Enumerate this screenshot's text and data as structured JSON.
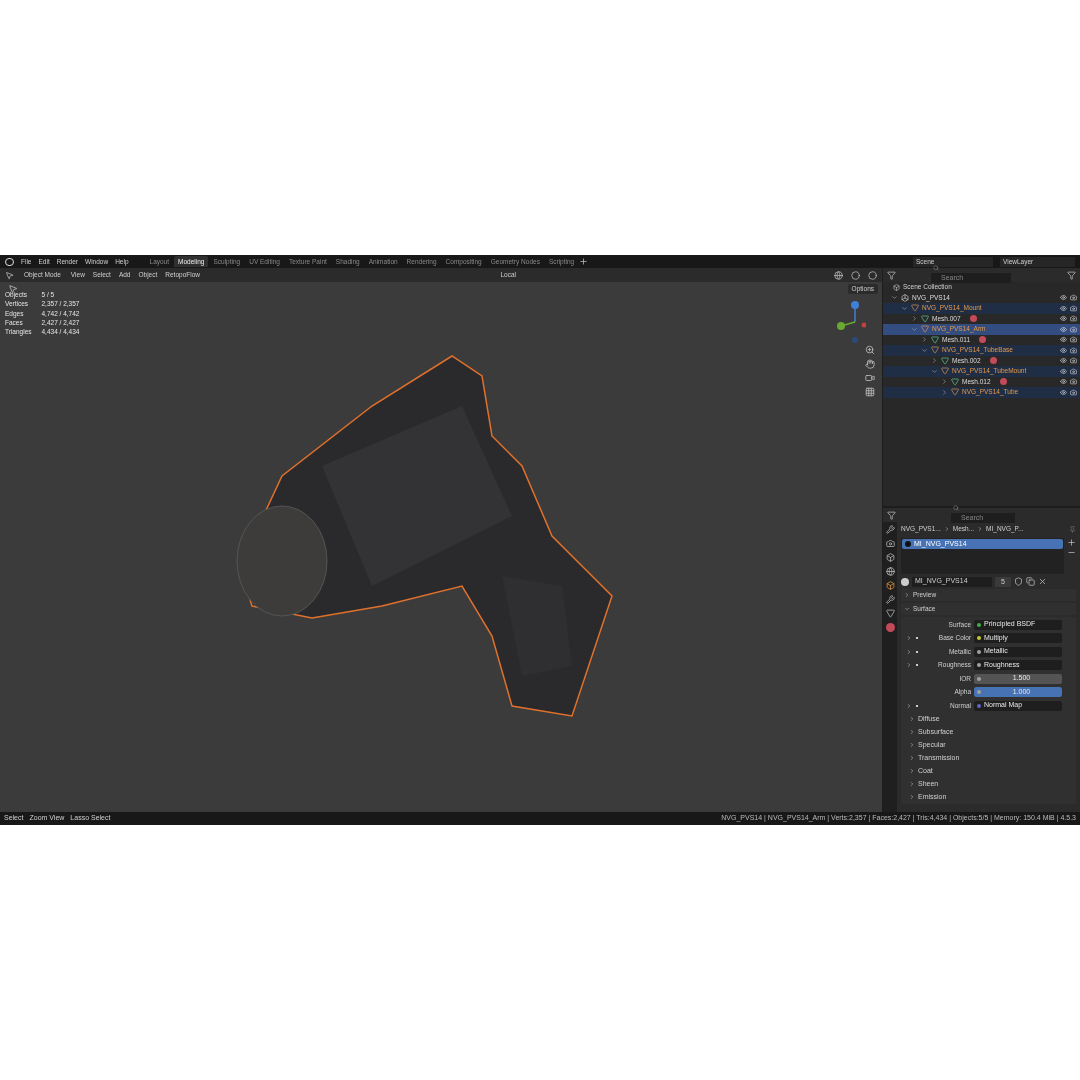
{
  "menu": [
    "File",
    "Edit",
    "Render",
    "Window",
    "Help"
  ],
  "workspaces": [
    {
      "label": "Layout",
      "selected": false
    },
    {
      "label": "Modeling",
      "selected": true
    },
    {
      "label": "Sculpting",
      "selected": false
    },
    {
      "label": "UV Editing",
      "selected": false
    },
    {
      "label": "Texture Paint",
      "selected": false
    },
    {
      "label": "Shading",
      "selected": false
    },
    {
      "label": "Animation",
      "selected": false
    },
    {
      "label": "Rendering",
      "selected": false
    },
    {
      "label": "Compositing",
      "selected": false
    },
    {
      "label": "Geometry Nodes",
      "selected": false
    },
    {
      "label": "Scripting",
      "selected": false
    }
  ],
  "scene": "Scene",
  "view_layer": "ViewLayer",
  "header": {
    "mode": "Object Mode",
    "menus": [
      "View",
      "Select",
      "Add",
      "Object",
      "RetopoFlow"
    ],
    "orientation": "Local",
    "options": "Options"
  },
  "stats": [
    {
      "label": "Objects",
      "value": "5 / 5"
    },
    {
      "label": "Vertices",
      "value": "2,357 / 2,357"
    },
    {
      "label": "Edges",
      "value": "4,742 / 4,742"
    },
    {
      "label": "Faces",
      "value": "2,427 / 2,427"
    },
    {
      "label": "Triangles",
      "value": "4,434 / 4,434"
    }
  ],
  "outliner": {
    "search": {
      "placeholder": "Search"
    },
    "root": "Scene Collection",
    "tree": [
      {
        "name": "NVG_PVS14",
        "kind": "collection",
        "selected": false,
        "active": false,
        "expanded": true,
        "children": [
          {
            "name": "NVG_PVS14_Mount",
            "kind": "object",
            "selected": true,
            "active": false,
            "expanded": true,
            "children": [
              {
                "name": "Mesh.007",
                "kind": "mesh",
                "selected": false,
                "active": false,
                "expanded": false
              },
              {
                "name": "NVG_PVS14_Arm",
                "kind": "object",
                "selected": true,
                "active": true,
                "expanded": true,
                "children": [
                  {
                    "name": "Mesh.011",
                    "kind": "mesh",
                    "selected": false,
                    "active": false,
                    "expanded": false
                  },
                  {
                    "name": "NVG_PVS14_TubeBase",
                    "kind": "object",
                    "selected": true,
                    "active": false,
                    "expanded": true,
                    "children": [
                      {
                        "name": "Mesh.002",
                        "kind": "mesh",
                        "selected": false,
                        "active": false,
                        "expanded": false
                      },
                      {
                        "name": "NVG_PVS14_TubeMount",
                        "kind": "object",
                        "selected": true,
                        "active": false,
                        "expanded": true,
                        "children": [
                          {
                            "name": "Mesh.012",
                            "kind": "mesh",
                            "selected": false,
                            "active": false,
                            "expanded": false
                          },
                          {
                            "name": "NVG_PVS14_Tube",
                            "kind": "object",
                            "selected": true,
                            "active": false,
                            "expanded": false
                          }
                        ]
                      }
                    ]
                  }
                ]
              }
            ]
          }
        ]
      }
    ]
  },
  "properties": {
    "search": {
      "placeholder": "Search"
    },
    "breadcrumb": [
      "NVG_PVS1...",
      "Mesh...",
      "MI_NVG_P..."
    ],
    "slots": [
      {
        "name": "MI_NVG_PVS14",
        "selected": true
      }
    ],
    "material": "MI_NVG_PVS14",
    "users": "5",
    "panels": [
      {
        "label": "Preview",
        "expanded": false
      },
      {
        "label": "Surface",
        "expanded": true
      }
    ],
    "fields": [
      {
        "kind": "link",
        "label": "Surface",
        "value": "Principled BSDF",
        "color": "#3fae48",
        "expandable": false
      },
      {
        "kind": "link",
        "label": "Base Color",
        "value": "Multiply",
        "color": "#c7c729",
        "expandable": true
      },
      {
        "kind": "link",
        "label": "Metallic",
        "value": "Metallic",
        "color": "#a1a1a1",
        "expandable": true
      },
      {
        "kind": "link",
        "label": "Roughness",
        "value": "Roughness",
        "color": "#a1a1a1",
        "expandable": true
      },
      {
        "kind": "number",
        "label": "IOR",
        "value": "1.500",
        "color": "#a1a1a1",
        "expandable": false
      },
      {
        "kind": "slider",
        "label": "Alpha",
        "value": "1.000",
        "color": "#a1a1a1",
        "expandable": false,
        "level": 1
      },
      {
        "kind": "link",
        "label": "Normal",
        "value": "Normal Map",
        "color": "#6363c7",
        "expandable": true
      }
    ],
    "subpanels": [
      "Diffuse",
      "Subsurface",
      "Specular",
      "Transmission",
      "Coat",
      "Sheen",
      "Emission"
    ]
  },
  "status": {
    "hints": [
      "Select",
      "Zoom View",
      "Lasso Select"
    ],
    "info": "NVG_PVS14 | NVG_PVS14_Arm | Verts:2,357 | Faces:2,427 | Tris:4,434 | Objects:5/5 | Memory: 150.4 MiB | 4.5.3"
  }
}
